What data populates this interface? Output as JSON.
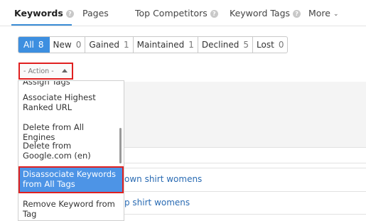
{
  "tabs": [
    {
      "label": "Keywords",
      "active": true
    },
    {
      "label": "Pages"
    },
    {
      "label": "Top Competitors"
    },
    {
      "label": "Keyword Tags"
    },
    {
      "label": "More"
    }
  ],
  "filters": [
    {
      "label": "All",
      "count": "8",
      "active": true
    },
    {
      "label": "New",
      "count": "0"
    },
    {
      "label": "Gained",
      "count": "1"
    },
    {
      "label": "Maintained",
      "count": "1"
    },
    {
      "label": "Declined",
      "count": "5"
    },
    {
      "label": "Lost",
      "count": "0"
    }
  ],
  "action_select": {
    "placeholder": "- Action -"
  },
  "dropdown": {
    "items": [
      "Assign Tags",
      "Associate Highest Ranked URL",
      "Delete from All Engines",
      "Delete from Google.com (en)",
      "Disassociate Keywords from All Tags",
      "Remove Keyword from Tag"
    ],
    "highlighted": "Disassociate Keywords from All Tags"
  },
  "table": {
    "row_links": [
      "own shirt womens",
      "p shirt womens"
    ]
  },
  "colors": {
    "accent": "#3d8fe0",
    "highlight_border": "#e02020",
    "link": "#2a6bb3"
  }
}
